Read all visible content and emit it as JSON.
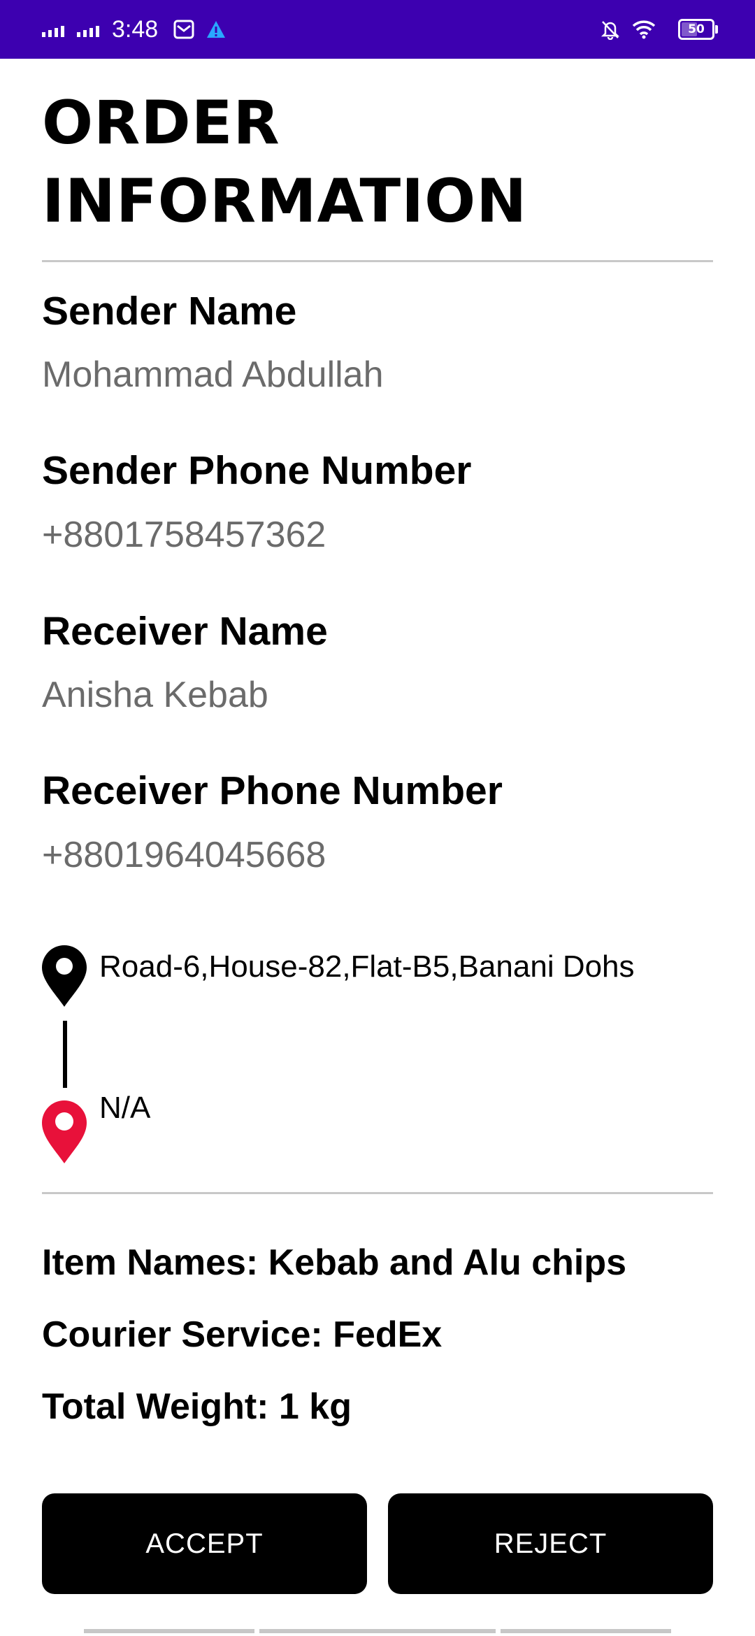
{
  "status_bar": {
    "time": "3:48",
    "battery": "50",
    "background": "#3d00b0"
  },
  "title": "ORDER INFORMATION",
  "sender": {
    "name_label": "Sender Name",
    "name_value": "Mohammad Abdullah",
    "phone_label": "Sender Phone Number",
    "phone_value": "+8801758457362"
  },
  "receiver": {
    "name_label": "Receiver Name",
    "name_value": "Anisha Kebab",
    "phone_label": "Receiver Phone Number",
    "phone_value": "+8801964045668"
  },
  "route": {
    "pickup_address": "Road-6,House-82,Flat-B5,Banani Dohs",
    "pickup_icon": "location-pin-black-icon",
    "dropoff_address": "N/A",
    "dropoff_icon": "location-pin-red-icon",
    "dropoff_color": "#e8113a"
  },
  "details": {
    "item_names": "Item Names: Kebab and Alu chips",
    "courier_service": "Courier Service: FedEx",
    "total_weight": "Total Weight: 1 kg"
  },
  "actions": {
    "accept_label": "ACCEPT",
    "reject_label": "REJECT"
  }
}
